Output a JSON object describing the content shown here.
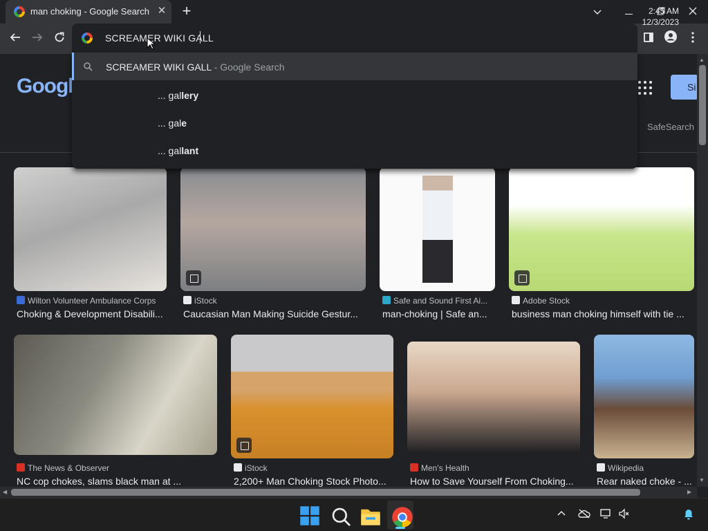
{
  "browser": {
    "tab_title": "man choking - Google Search",
    "tab_close": "✕",
    "new_tab": "+",
    "omnibox_text": "SCREAMER WIKI GALL"
  },
  "suggestions": {
    "top": {
      "query": "SCREAMER WIKI GALL",
      "suffix": " - Google Search"
    },
    "items": [
      {
        "prefix": "... gal",
        "bold": "lery"
      },
      {
        "prefix": "... gal",
        "bold": "e"
      },
      {
        "prefix": "... gal",
        "bold": "lant"
      }
    ]
  },
  "page": {
    "logo": "Google",
    "safesearch": "SafeSearch",
    "signin": "Si"
  },
  "results": [
    {
      "source": "Wilton Volunteer Ambulance Corps",
      "caption": "Choking & Development Disabili..."
    },
    {
      "source": "iStock",
      "caption": "Caucasian Man Making Suicide Gestur..."
    },
    {
      "source": "Safe and Sound First Ai...",
      "caption": "man-choking | Safe an..."
    },
    {
      "source": "Adobe Stock",
      "caption": "business man choking himself with tie ..."
    },
    {
      "source": "The News & Observer",
      "caption": "NC cop chokes, slams black man at ..."
    },
    {
      "source": "iStock",
      "caption": "2,200+ Man Choking Stock Photo..."
    },
    {
      "source": "Men's Health",
      "caption": "How to Save Yourself From Choking..."
    },
    {
      "source": "Wikipedia",
      "caption": "Rear naked choke - ..."
    }
  ],
  "taskbar": {
    "time": "2:45 AM",
    "date": "12/3/2023"
  },
  "colors": {
    "background": "#202124",
    "toolbar": "#35363a",
    "accent": "#8ab4f8"
  }
}
